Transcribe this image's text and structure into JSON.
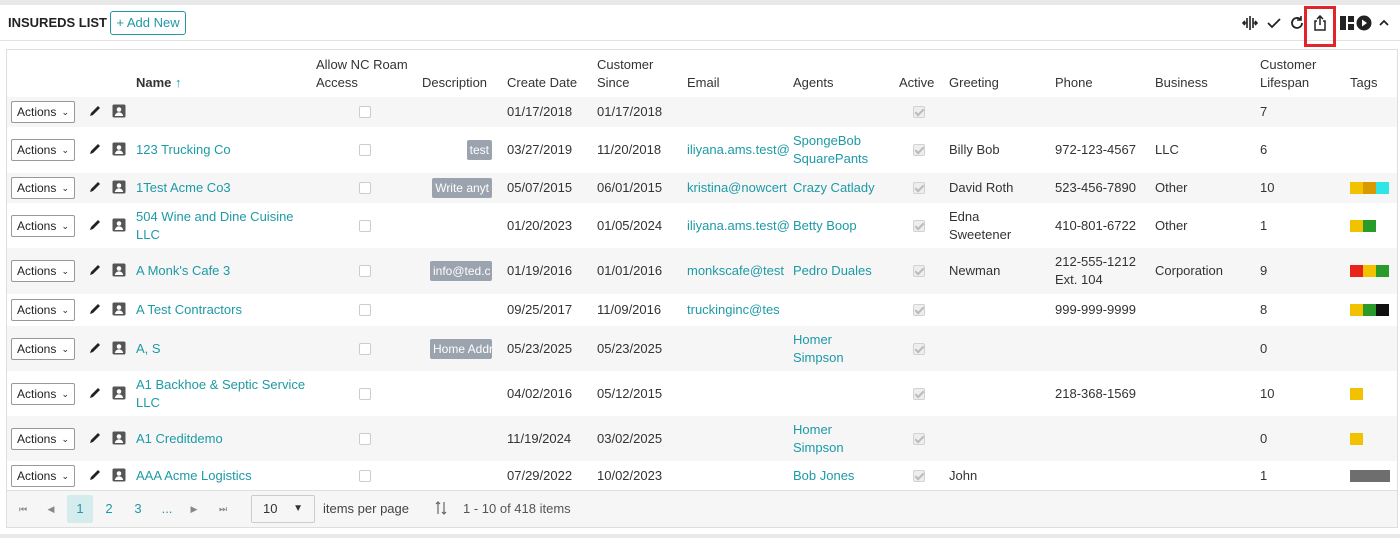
{
  "header": {
    "title": "INSUREDS LIST",
    "add_label": "+ Add New",
    "tools": [
      "columns-icon",
      "check-icon",
      "refresh-icon",
      "export-icon",
      "layout-icon",
      "play-icon",
      "chevron-up-icon"
    ]
  },
  "columns": {
    "name": "Name",
    "name_sort": "↑",
    "allow_nc_1": "Allow NC Roam",
    "allow_nc_2": "Access",
    "description": "Description",
    "create_date": "Create Date",
    "customer_since_1": "Customer",
    "customer_since_2": "Since",
    "email": "Email",
    "agents": "Agents",
    "active": "Active",
    "greeting": "Greeting",
    "phone": "Phone",
    "business": "Business",
    "lifespan_1": "Customer",
    "lifespan_2": "Lifespan",
    "tags": "Tags"
  },
  "actions_label": "Actions",
  "rows": [
    {
      "name": "",
      "description": "",
      "create": "01/17/2018",
      "since": "01/17/2018",
      "email": "",
      "agents": [
        "",
        ""
      ],
      "greeting": [
        "",
        ""
      ],
      "phone": [
        "",
        ""
      ],
      "business": "",
      "lifespan": "7"
    },
    {
      "name": "123 Trucking Co",
      "description": "test",
      "create": "03/27/2019",
      "since": "11/20/2018",
      "email": "iliyana.ams.test@",
      "agents": [
        "SpongeBob",
        "SquarePants"
      ],
      "greeting": [
        "Billy Bob",
        ""
      ],
      "phone": [
        "972-123-4567",
        ""
      ],
      "business": "LLC",
      "lifespan": "6"
    },
    {
      "name": "1Test Acme Co3",
      "description": "Write anyt",
      "create": "05/07/2015",
      "since": "06/01/2015",
      "email": "kristina@nowcert",
      "agents": [
        "Crazy Catlady",
        ""
      ],
      "greeting": [
        "David Roth",
        ""
      ],
      "phone": [
        "523-456-7890",
        ""
      ],
      "business": "Other",
      "lifespan": "10"
    },
    {
      "name": "504 Wine and Dine Cuisine LLC",
      "description": "",
      "create": "01/20/2023",
      "since": "01/05/2024",
      "email": "iliyana.ams.test@",
      "agents": [
        "Betty Boop",
        ""
      ],
      "greeting": [
        "Edna",
        "Sweetener"
      ],
      "phone": [
        "410-801-6722",
        ""
      ],
      "business": "Other",
      "lifespan": "1"
    },
    {
      "name": "A Monk's Cafe 3",
      "description": "info@ted.c",
      "create": "01/19/2016",
      "since": "01/01/2016",
      "email": "monkscafe@test",
      "agents": [
        "Pedro Duales",
        ""
      ],
      "greeting": [
        "Newman",
        ""
      ],
      "phone": [
        "212-555-1212",
        "Ext. 104"
      ],
      "business": "Corporation",
      "lifespan": "9"
    },
    {
      "name": "A Test Contractors",
      "description": "",
      "create": "09/25/2017",
      "since": "11/09/2016",
      "email": "truckinginc@tes",
      "agents": [
        "",
        ""
      ],
      "greeting": [
        "",
        ""
      ],
      "phone": [
        "999-999-9999",
        ""
      ],
      "business": "",
      "lifespan": "8"
    },
    {
      "name": "A, S",
      "description": "Home Addre",
      "create": "05/23/2025",
      "since": "05/23/2025",
      "email": "",
      "agents": [
        "Homer",
        "Simpson"
      ],
      "greeting": [
        "",
        ""
      ],
      "phone": [
        "",
        ""
      ],
      "business": "",
      "lifespan": "0"
    },
    {
      "name": "A1 Backhoe & Septic Service LLC",
      "description": "",
      "create": "04/02/2016",
      "since": "05/12/2015",
      "email": "",
      "agents": [
        "",
        ""
      ],
      "greeting": [
        "",
        ""
      ],
      "phone": [
        "218-368-1569",
        ""
      ],
      "business": "",
      "lifespan": "10"
    },
    {
      "name": "A1 Creditdemo",
      "description": "",
      "create": "11/19/2024",
      "since": "03/02/2025",
      "email": "",
      "agents": [
        "Homer",
        "Simpson"
      ],
      "greeting": [
        "",
        ""
      ],
      "phone": [
        "",
        ""
      ],
      "business": "",
      "lifespan": "0"
    },
    {
      "name": "AAA Acme Logistics",
      "description": "",
      "create": "07/29/2022",
      "since": "10/02/2023",
      "email": "",
      "agents": [
        "Bob Jones",
        ""
      ],
      "greeting": [
        "John",
        ""
      ],
      "phone": [
        "",
        ""
      ],
      "business": "",
      "lifespan": "1"
    }
  ],
  "tag_colors": [
    [],
    [],
    [
      "#f2c200",
      "#d99a00",
      "#2ee6e6"
    ],
    [
      "#f2c200",
      "#2a9a2a"
    ],
    [
      "#e8231c",
      "#f2c200",
      "#2a9a2a"
    ],
    [
      "#f2c200",
      "#2a9a2a",
      "#111111"
    ],
    [],
    [
      "#f2c200"
    ],
    [
      "#f2c200"
    ],
    [
      "#6e6e6e"
    ]
  ],
  "pager": {
    "pages": [
      "1",
      "2",
      "3",
      "..."
    ],
    "page_size": "10",
    "items_per_page": "items per page",
    "summary": "1 - 10 of 418 items"
  }
}
